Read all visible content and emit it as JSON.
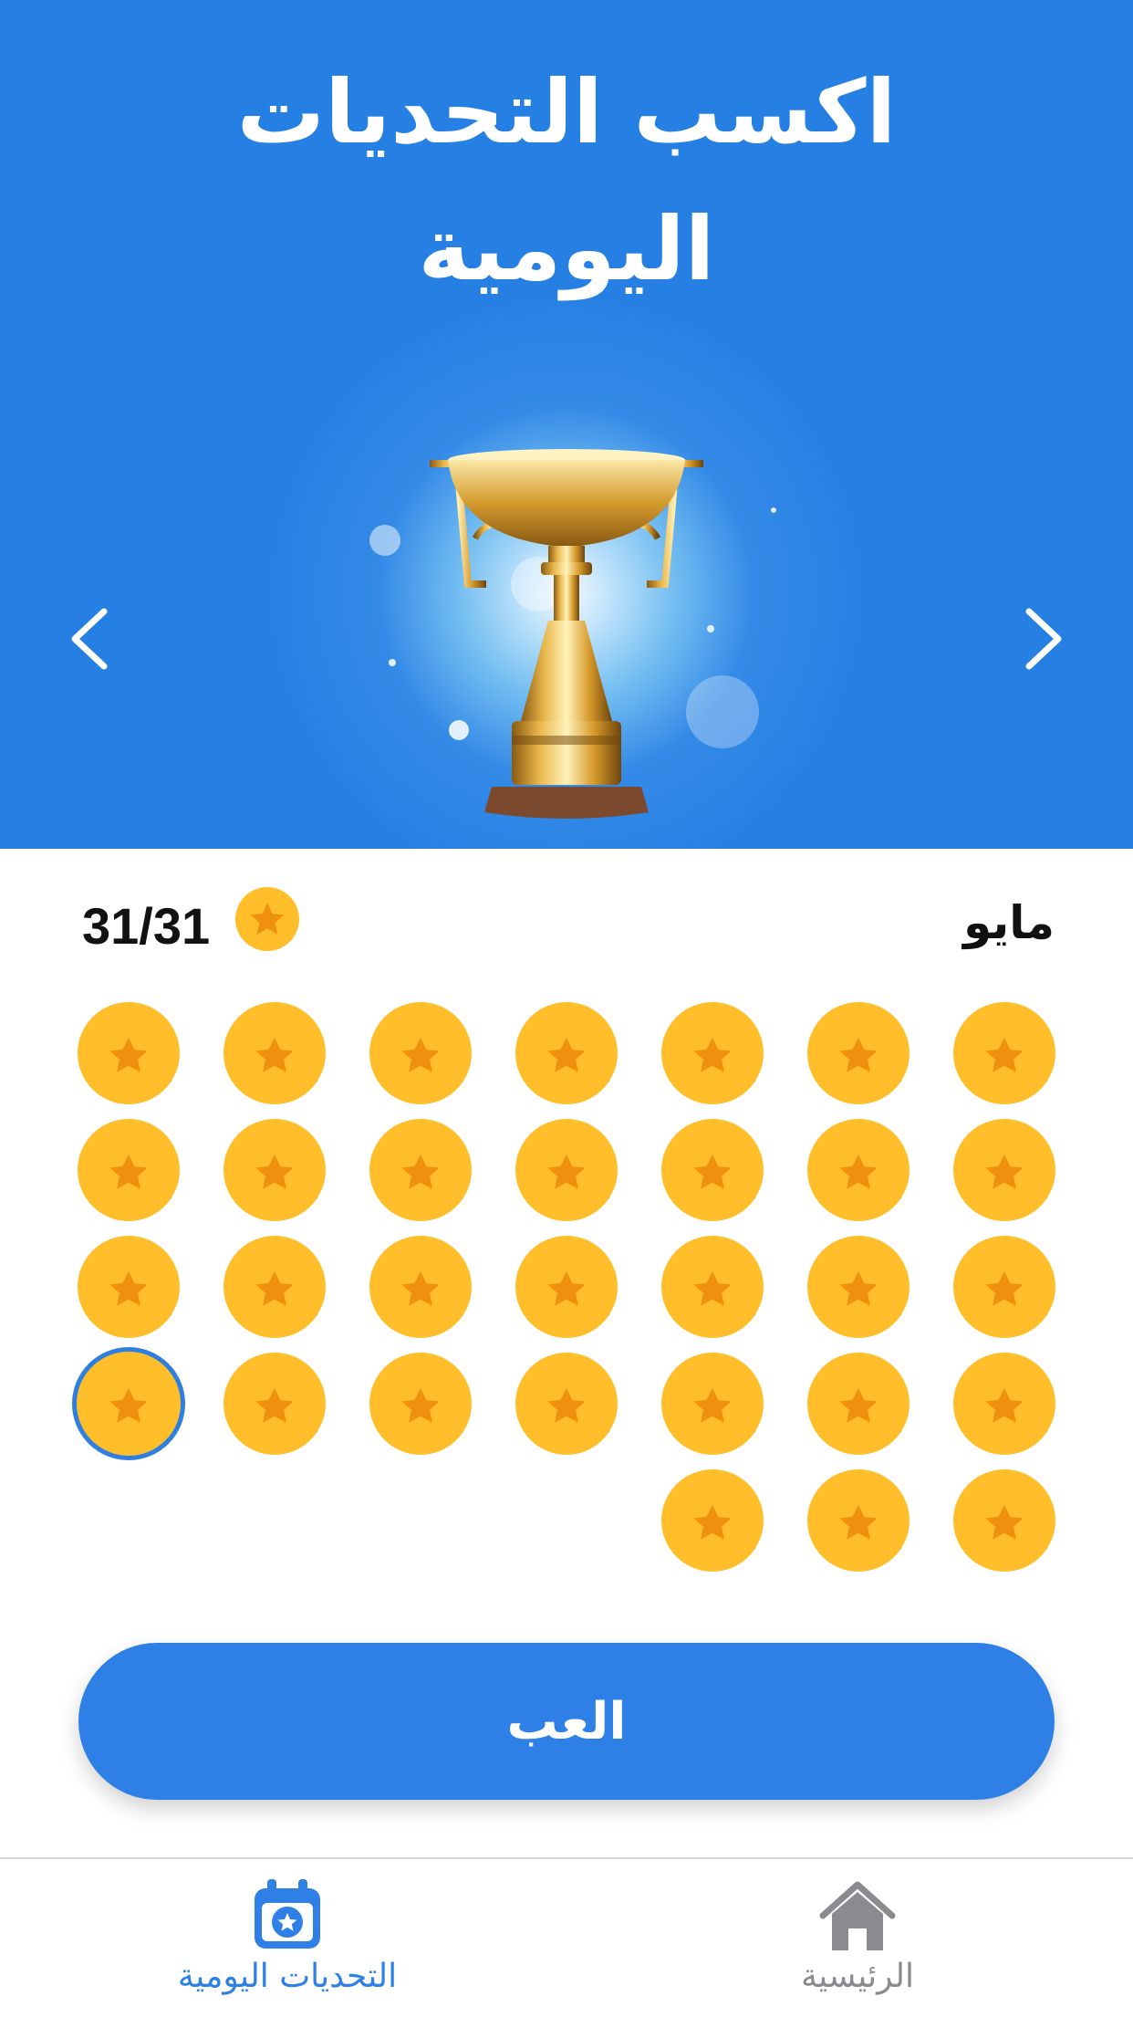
{
  "hero": {
    "title_line1": "اكسب التحديات",
    "title_line2": "اليومية",
    "background_color": "#2680e3",
    "prev_icon": "chevron-left-icon",
    "next_icon": "chevron-right-icon",
    "image": "trophy"
  },
  "calendar": {
    "month": "مايو",
    "progress": "31/31",
    "days_in_month": 31,
    "completed_days": 31,
    "today_index": 27,
    "coin_color": "#ffbe2a",
    "star_color": "#f0900f",
    "today_ring_color": "#2f7fe0"
  },
  "play_button": {
    "label": "العب",
    "color": "#2f80e6"
  },
  "tab_bar": {
    "items": [
      {
        "label": "التحديات اليومية",
        "icon": "calendar-star-icon",
        "active": true,
        "color": "#2f80e6"
      },
      {
        "label": "الرئيسية",
        "icon": "home-icon",
        "active": false,
        "color": "#8a8a8f"
      }
    ]
  }
}
